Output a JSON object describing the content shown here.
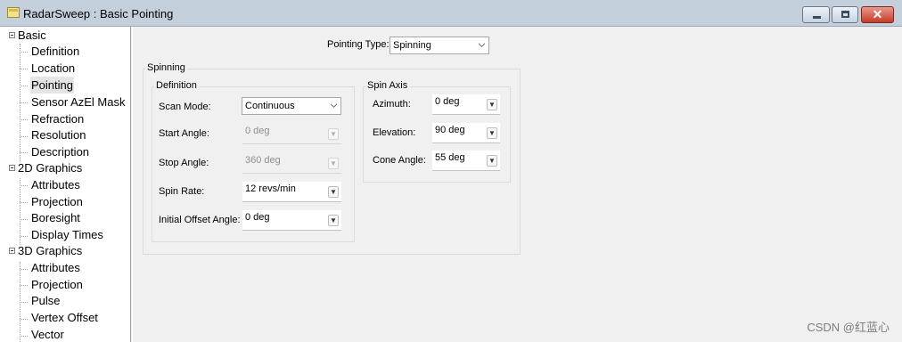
{
  "window": {
    "title": "RadarSweep : Basic Pointing",
    "minimize_icon": "minimize-icon",
    "maximize_icon": "maximize-icon",
    "close_icon": "close-icon"
  },
  "tree": {
    "groups": [
      {
        "label": "Basic",
        "items": [
          "Definition",
          "Location",
          "Pointing",
          "Sensor AzEl Mask",
          "Refraction",
          "Resolution",
          "Description"
        ]
      },
      {
        "label": "2D Graphics",
        "items": [
          "Attributes",
          "Projection",
          "Boresight",
          "Display Times"
        ]
      },
      {
        "label": "3D Graphics",
        "items": [
          "Attributes",
          "Projection",
          "Pulse",
          "Vertex Offset",
          "Vector"
        ]
      }
    ],
    "selected": "Pointing"
  },
  "pointing_type": {
    "label": "Pointing Type:",
    "value": "Spinning"
  },
  "spinning": {
    "title": "Spinning",
    "definition": {
      "title": "Definition",
      "scan_mode": {
        "label": "Scan Mode:",
        "value": "Continuous"
      },
      "start_angle": {
        "label": "Start Angle:",
        "value": "0 deg"
      },
      "stop_angle": {
        "label": "Stop Angle:",
        "value": "360 deg"
      },
      "spin_rate": {
        "label": "Spin Rate:",
        "value": "12 revs/min"
      },
      "initial_offset": {
        "label": "Initial Offset Angle:",
        "value": "0 deg"
      }
    },
    "spin_axis": {
      "title": "Spin Axis",
      "azimuth": {
        "label": "Azimuth:",
        "value": "0 deg"
      },
      "elevation": {
        "label": "Elevation:",
        "value": "90 deg"
      },
      "cone_angle": {
        "label": "Cone Angle:",
        "value": "55 deg"
      }
    }
  },
  "watermark": "CSDN @红蓝心"
}
